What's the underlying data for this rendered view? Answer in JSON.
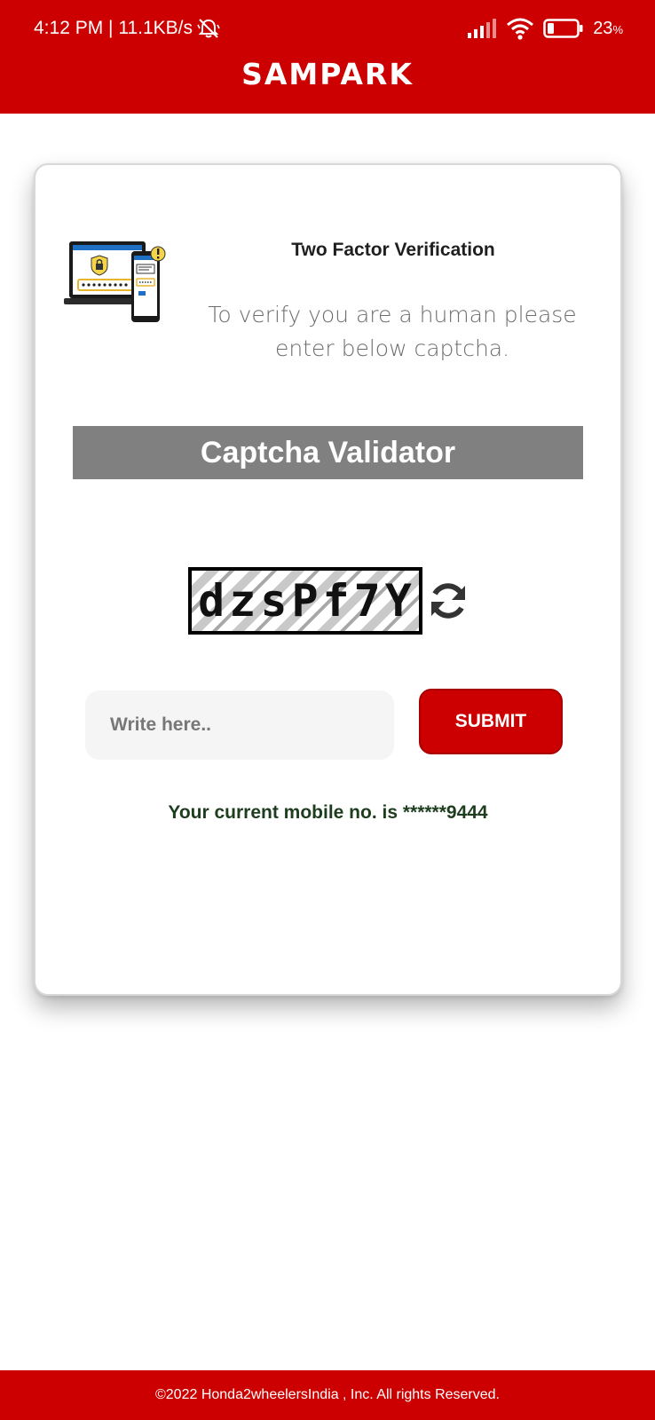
{
  "status_bar": {
    "time_speed": "4:12 PM | 11.1KB/s",
    "battery_percent": "23",
    "battery_unit": "%",
    "battery_level": 0.23
  },
  "header": {
    "brand": "SAMPARK"
  },
  "card": {
    "title": "Two Factor Verification",
    "subtitle": "To verify you are a human please enter below captcha.",
    "banner": "Captcha Validator",
    "captcha_code": "dzsPf7Y",
    "input_placeholder": "Write here..",
    "input_value": "",
    "submit_label": "SUBMIT",
    "mobile_info": "Your current mobile no. is ******9444"
  },
  "footer": {
    "copyright": "©2022 Honda2wheelersIndia , Inc. All rights Reserved."
  },
  "colors": {
    "brand_red": "#cc0000",
    "banner_gray": "#808080",
    "mobile_text_green": "#1e3d1e"
  },
  "icons": {
    "mute": "bell-off-icon",
    "signal": "signal-icon",
    "wifi": "wifi-icon",
    "battery": "battery-icon",
    "refresh": "refresh-icon",
    "illustration": "two-factor-devices-illustration"
  }
}
